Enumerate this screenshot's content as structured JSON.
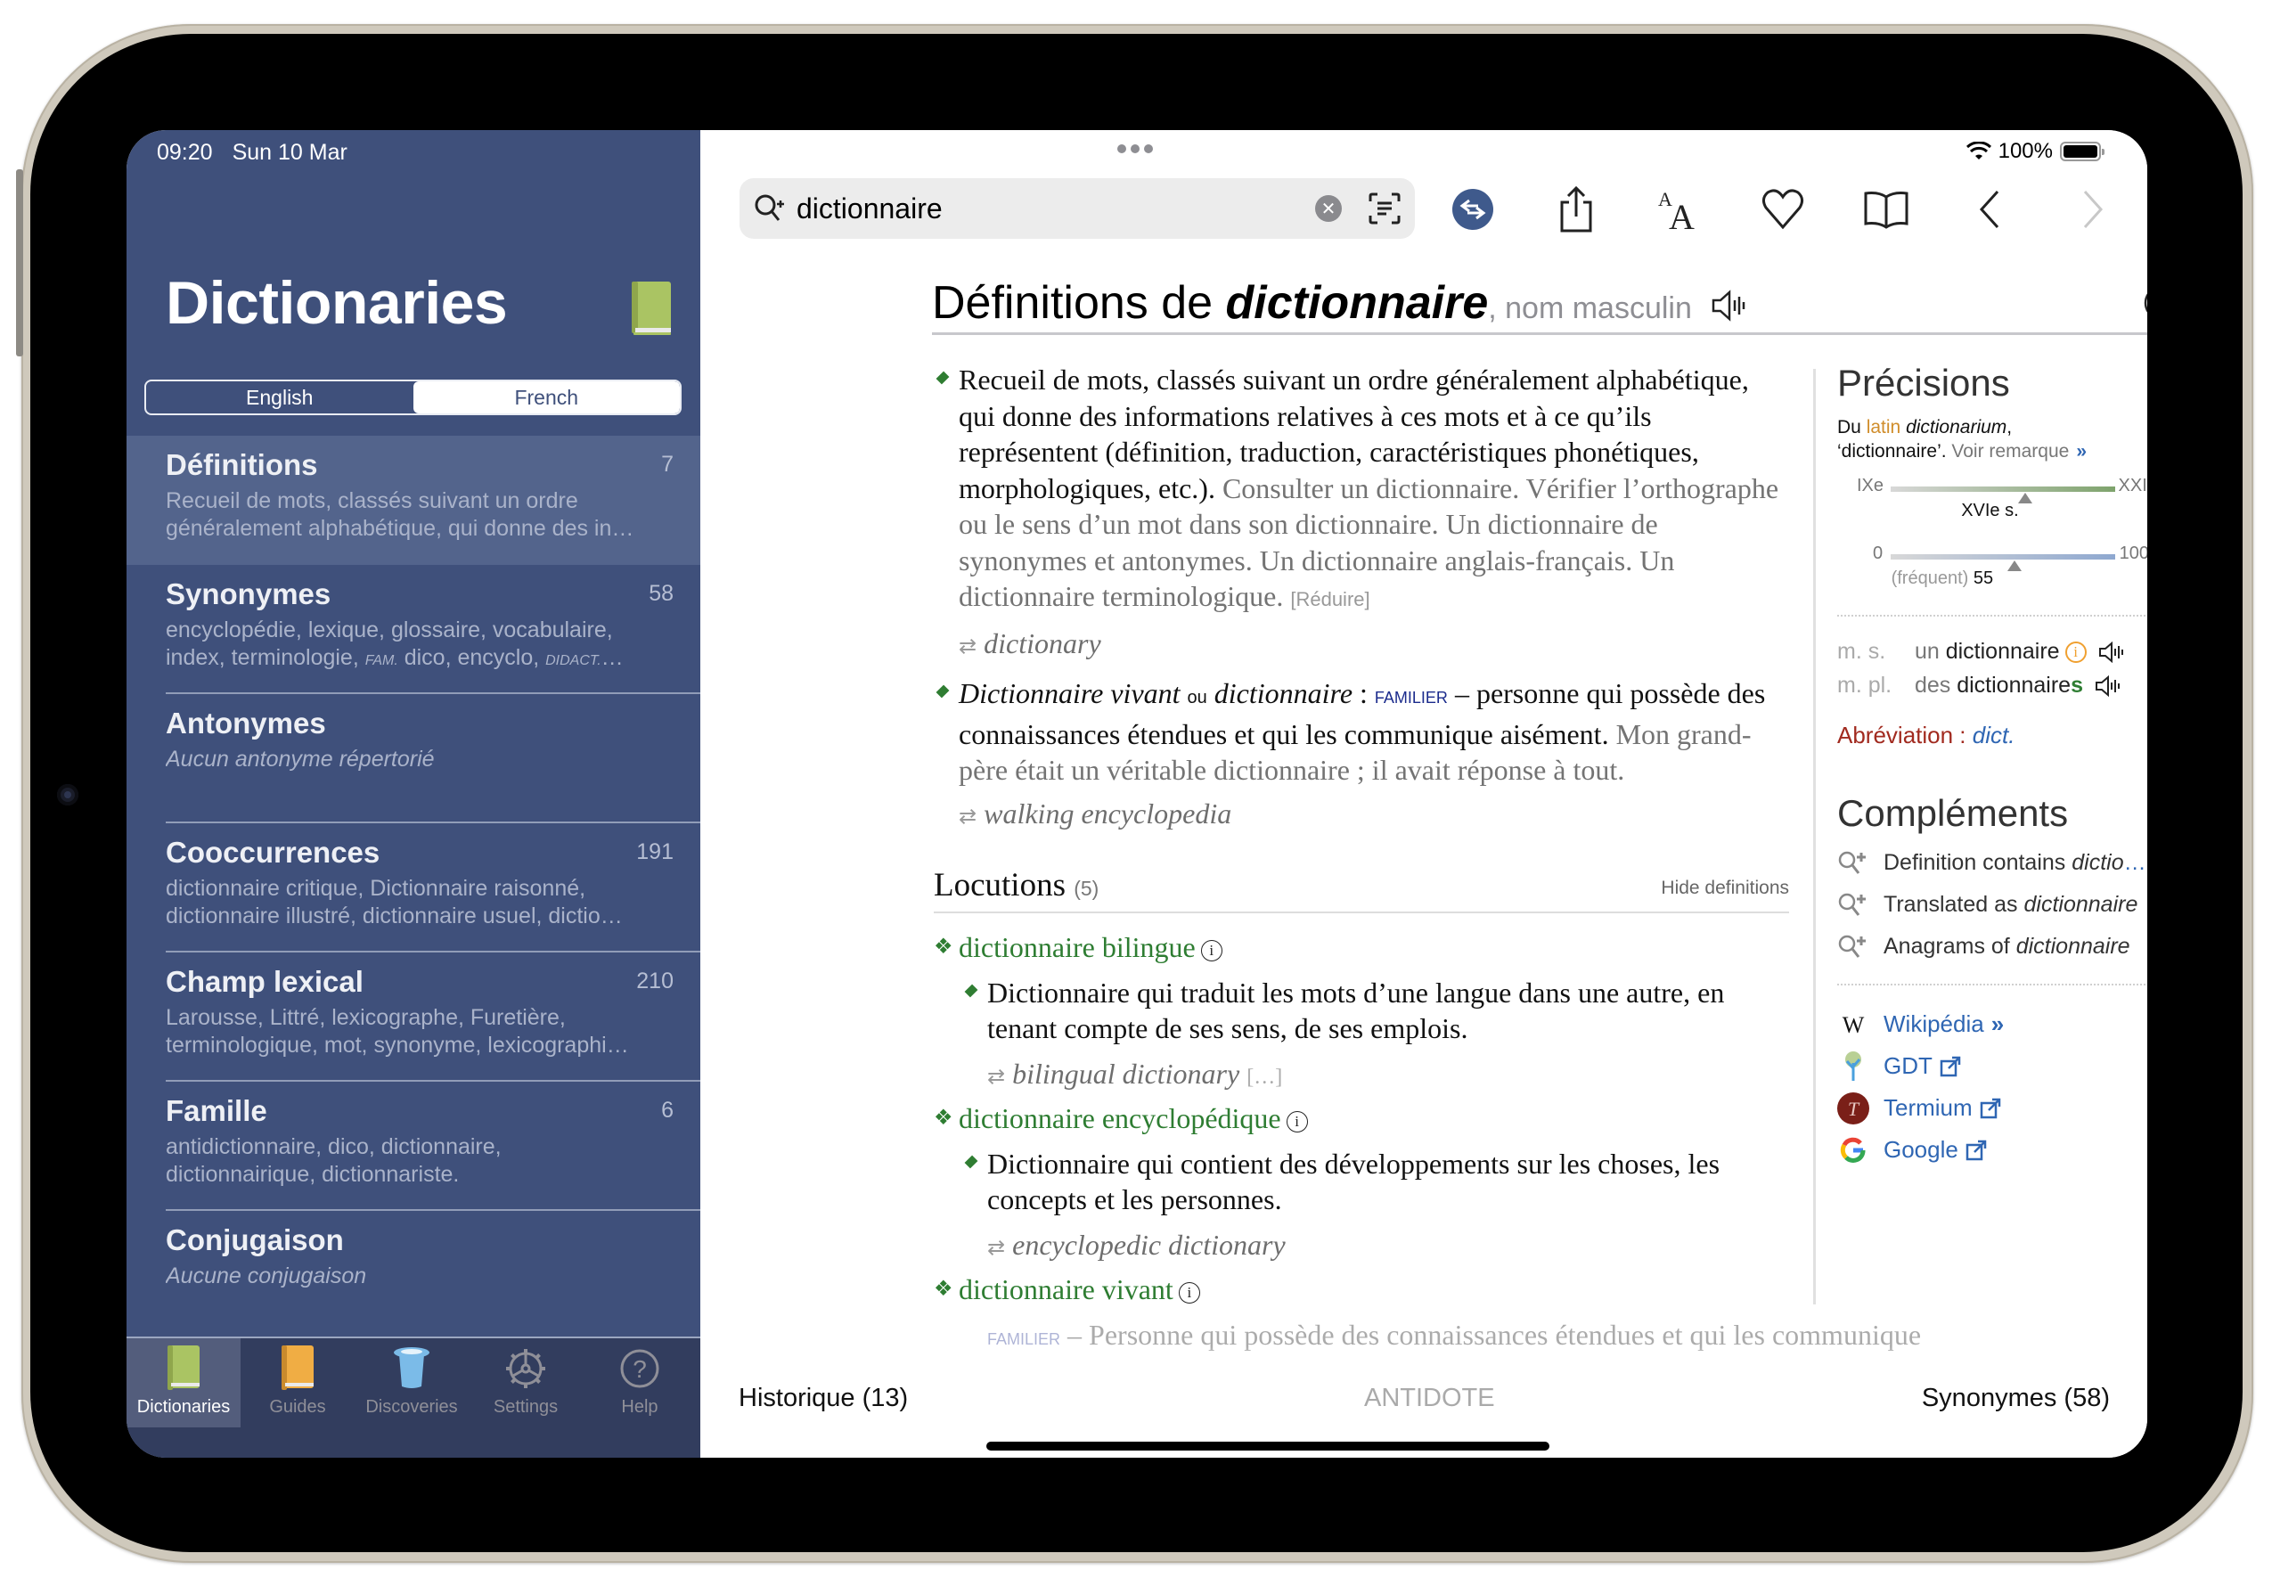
{
  "status_bar": {
    "time": "09:20",
    "date": "Sun 10 Mar",
    "battery": "100%"
  },
  "sidebar": {
    "title": "Dictionaries",
    "segments": [
      {
        "label": "English",
        "active": false
      },
      {
        "label": "French",
        "active": true
      }
    ],
    "items": [
      {
        "name": "Définitions",
        "count": "7",
        "desc": "Recueil de mots, classés suivant un ordre",
        "desc2": "généralement alphabétique, qui donne des in…",
        "selected": true
      },
      {
        "name": "Synonymes",
        "count": "58",
        "desc": "encyclopédie, lexique, glossaire, vocabulaire,",
        "desc2a": "index, terminologie, ",
        "tag1": "fam.",
        "desc2b": " dico, encyclo, ",
        "tag2": "didact.",
        "desc2c": "…"
      },
      {
        "name": "Antonymes",
        "count": "",
        "desc": "Aucun antonyme répertorié"
      },
      {
        "name": "Cooccurrences",
        "count": "191",
        "desc": "dictionnaire critique, Dictionnaire raisonné,",
        "desc2": "dictionnaire illustré, dictionnaire usuel, dictio…"
      },
      {
        "name": "Champ lexical",
        "count": "210",
        "desc": "Larousse, Littré, lexicographe, Furetière,",
        "desc2": "terminologique, mot, synonyme, lexicographi…"
      },
      {
        "name": "Famille",
        "count": "6",
        "desc": "antidictionnaire, dico, dictionnaire,",
        "desc2": "dictionnairique, dictionnariste."
      },
      {
        "name": "Conjugaison",
        "count": "",
        "desc": "Aucune conjugaison"
      }
    ],
    "tabs": [
      {
        "label": "Dictionaries",
        "icon": "green-book-icon",
        "active": true
      },
      {
        "label": "Guides",
        "icon": "orange-book-icon"
      },
      {
        "label": "Discoveries",
        "icon": "top-hat-icon"
      },
      {
        "label": "Settings",
        "icon": "gear-icon"
      },
      {
        "label": "Help",
        "icon": "question-circle-icon"
      }
    ]
  },
  "search": {
    "value": "dictionnaire",
    "placeholder": ""
  },
  "toolbar": {
    "icons": [
      "translate-swap-icon",
      "share-icon",
      "text-size-icon",
      "heart-icon",
      "book-open-icon",
      "chevron-left-icon",
      "chevron-right-icon"
    ]
  },
  "entry": {
    "heading_prefix": "Définitions de ",
    "headword": "dictionnaire",
    "pos": ", nom masculin",
    "definitions": [
      {
        "text": "Recueil de mots, classés suivant un ordre généralement alphabétique, qui donne des informations relatives à ces mots et à ce qu’ils représentent (définition, traduction, caractéristiques phonétiques, morphologiques, etc.).",
        "examples": " Consulter un dictionnaire. Vérifier l’orthographe ou le sens d’un mot dans son dictionnaire. Un dictionnaire de synonymes et antonymes. Un dictionnaire anglais-français. Un dictionnaire terminologique.",
        "reduce": "[Réduire]",
        "translation": "dictionary"
      },
      {
        "term1": "Dictionnaire vivant",
        "ou": "ou",
        "term2": "dictionnaire",
        "colon": " : ",
        "register": "familier",
        "text": " – personne qui possède des connaissances étendues et qui les communique aisément.",
        "example": "Mon grand-père était un véritable dictionnaire ; il avait réponse à tout.",
        "translation": "walking encyclopedia"
      }
    ],
    "locutions": {
      "title": "Locutions",
      "count": "(5)",
      "hide_label": "Hide definitions",
      "items": [
        {
          "term": "dictionnaire bilingue",
          "def": "Dictionnaire qui traduit les mots d’une langue dans une autre, en tenant compte de ses sens, de ses emplois.",
          "translation": "bilingual dictionary",
          "more": "[…]"
        },
        {
          "term": "dictionnaire encyclopédique",
          "def": "Dictionnaire qui contient des développements sur les choses, les concepts et les personnes.",
          "translation": "encyclopedic dictionary",
          "more": ""
        },
        {
          "term": "dictionnaire vivant",
          "def_register": "familier",
          "def": " – Personne qui possède des connaissances étendues et qui les communique"
        }
      ]
    }
  },
  "precisions": {
    "title": "Précisions",
    "etym_prefix": "Du ",
    "etym_lang": "latin",
    "etym_word": "dictionarium",
    "etym_gloss": "‘dictionnaire’. ",
    "voir": "Voir remarque",
    "era": {
      "min_label": "IXe",
      "max_label": "XXIe s.",
      "value_label": "XVIe s.",
      "value_fraction": 0.6
    },
    "frequency": {
      "min_label": "0",
      "max_label": "100",
      "qualifier": "(fréquent)",
      "value": 55
    },
    "forms": [
      {
        "tag": "m. s.",
        "article": "un",
        "stem": "dictionnaire",
        "ending": "",
        "info": true
      },
      {
        "tag": "m. pl.",
        "article": "des",
        "stem": "dictionnaire",
        "ending": "s",
        "info": false
      }
    ],
    "abbr_label": "Abréviation : ",
    "abbr_value": "dict."
  },
  "complements": {
    "title": "Compléments",
    "items": [
      {
        "prefix": "Definition contains ",
        "word": "dictio",
        "ellipsis": "…"
      },
      {
        "prefix": "Translated as ",
        "word": "dictionnaire",
        "ellipsis": ""
      },
      {
        "prefix": "Anagrams of ",
        "word": "dictionnaire",
        "ellipsis": ""
      }
    ],
    "links": [
      {
        "label": "Wikipédia",
        "icon": "wikipedia-icon",
        "type": "internal"
      },
      {
        "label": "GDT",
        "icon": "gdt-tree-icon",
        "type": "external"
      },
      {
        "label": "Termium",
        "icon": "termium-icon",
        "type": "external"
      },
      {
        "label": "Google",
        "icon": "google-icon",
        "type": "external"
      }
    ]
  },
  "bottom_bar": {
    "history": "Historique (13)",
    "brand": "ANTIDOTE",
    "synonyms": "Synonymes (58)"
  },
  "colors": {
    "sidebar_bg": "#3f507b",
    "accent_green": "#2e7d32",
    "link_blue": "#2f66b3",
    "abbr_red": "#a12a1f"
  }
}
